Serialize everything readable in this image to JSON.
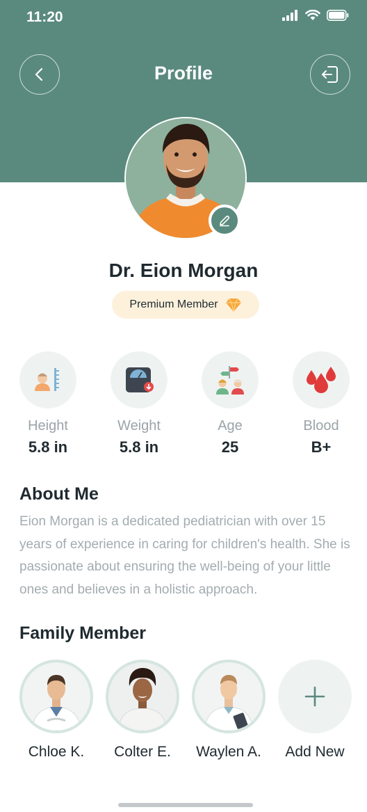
{
  "status_bar": {
    "time": "11:20"
  },
  "header": {
    "title": "Profile"
  },
  "profile": {
    "name": "Dr. Eion Morgan",
    "badge": "Premium Member"
  },
  "stats": [
    {
      "label": "Height",
      "value": "5.8 in",
      "icon": "height-icon"
    },
    {
      "label": "Weight",
      "value": "5.8 in",
      "icon": "weight-scale-icon"
    },
    {
      "label": "Age",
      "value": "25",
      "icon": "age-icon"
    },
    {
      "label": "Blood",
      "value": "B+",
      "icon": "blood-drop-icon"
    }
  ],
  "about": {
    "title": "About Me",
    "text": "Eion Morgan is a dedicated pediatrician with over 15 years of experience in caring for children's health. She is passionate about ensuring the well-being of your little ones and believes in a holistic approach."
  },
  "family": {
    "title": "Family Member",
    "members": [
      {
        "name": "Chloe K."
      },
      {
        "name": "Colter E."
      },
      {
        "name": "Waylen A."
      }
    ],
    "add_label": "Add New"
  },
  "colors": {
    "primary": "#5a8a7e",
    "badge_bg": "#fdf1dc",
    "text": "#1f2a30",
    "muted": "#9aa4a8"
  }
}
